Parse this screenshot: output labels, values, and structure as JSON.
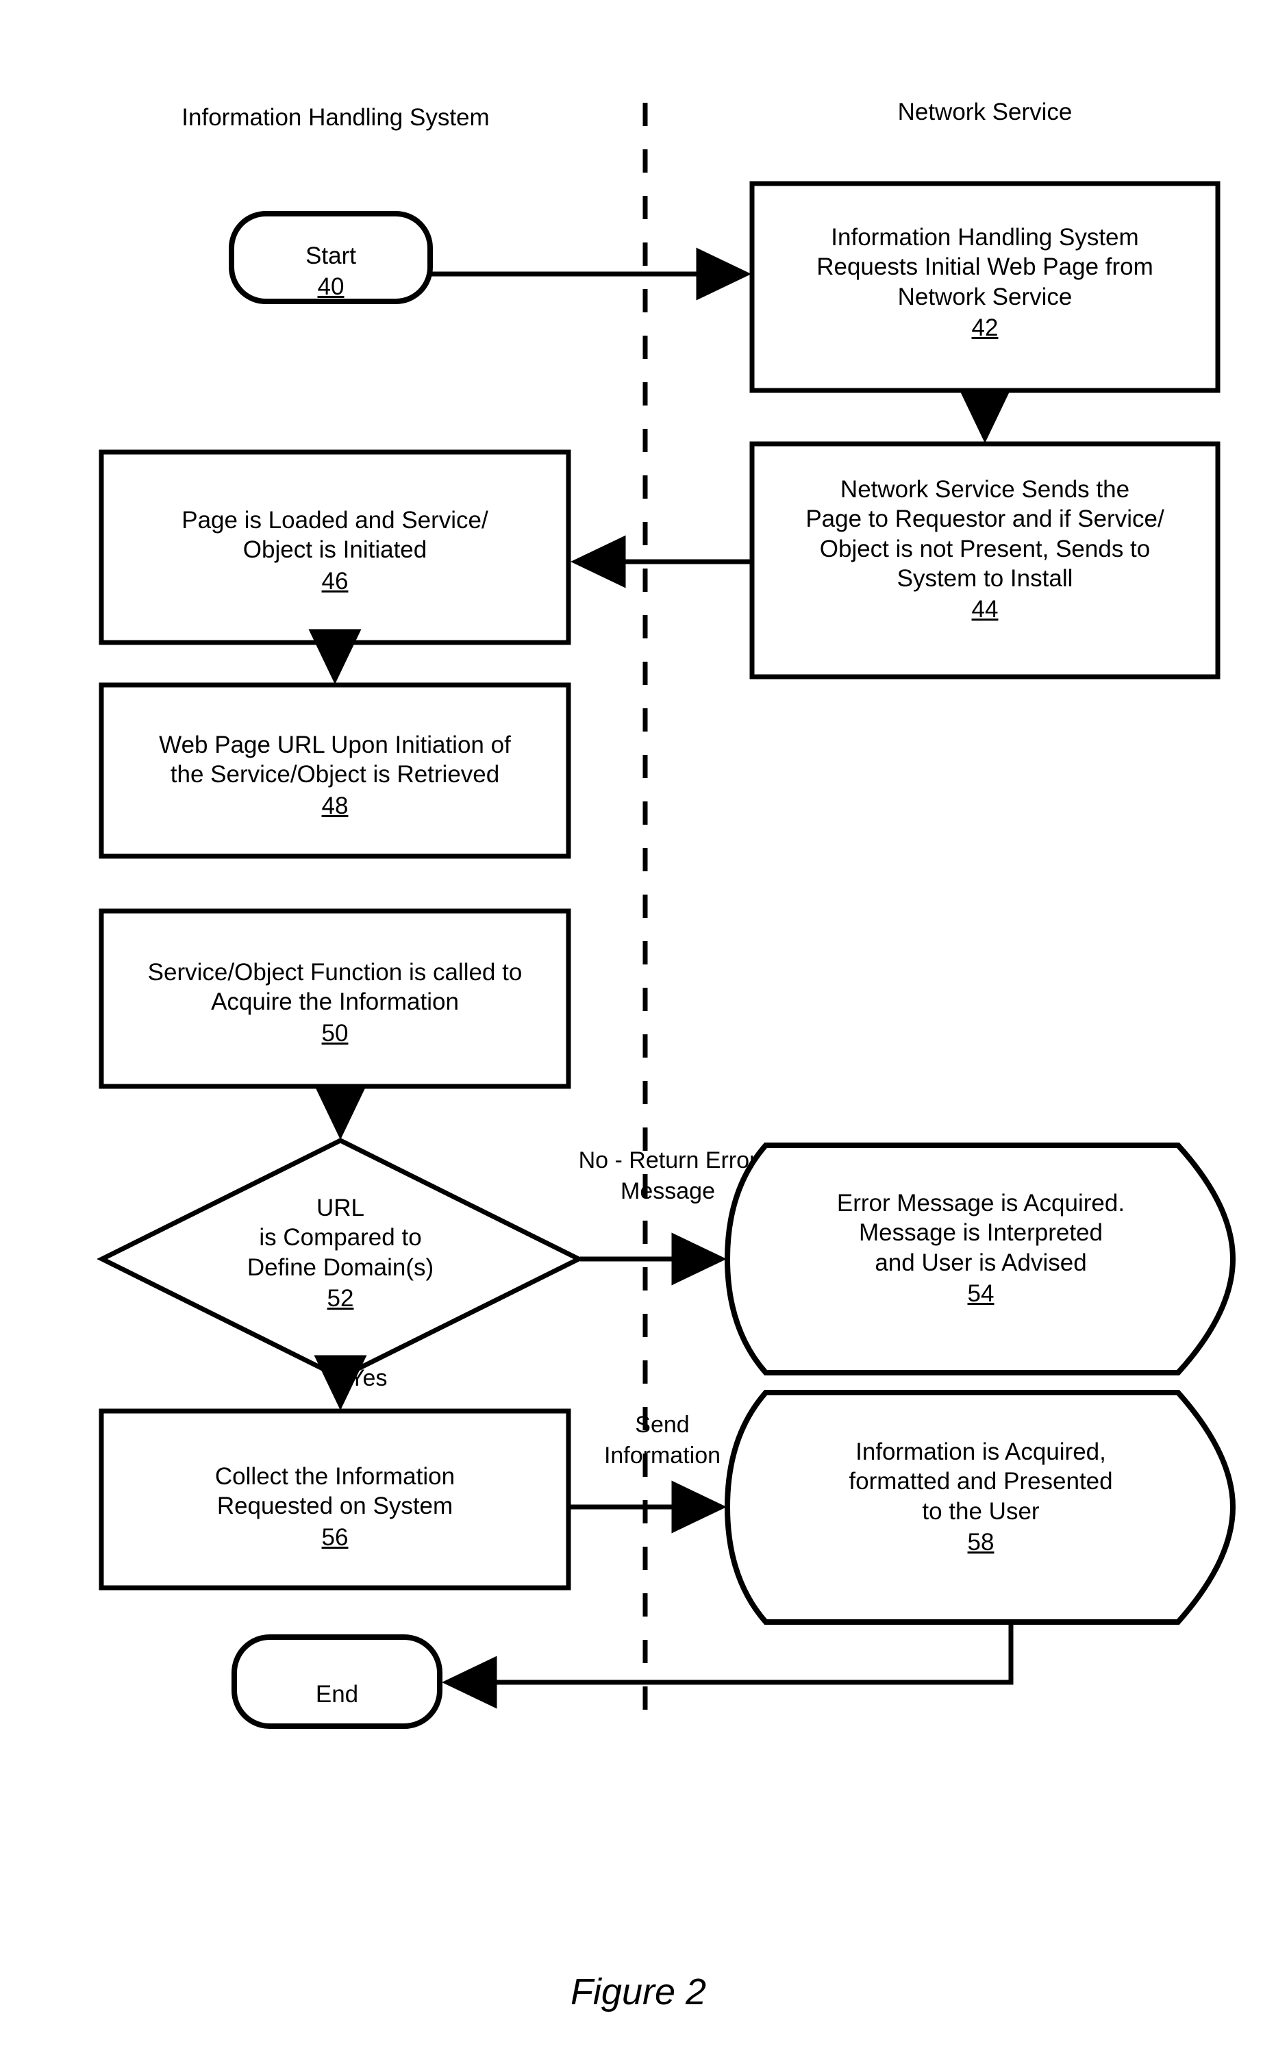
{
  "figure": {
    "caption": "Figure 2"
  },
  "swimlanes": [
    {
      "id": "information-handling-system",
      "label": "Information Handling System"
    },
    {
      "id": "network-service",
      "label": "Network Service"
    }
  ],
  "nodes": [
    {
      "id": "start",
      "shape": "terminator",
      "lane": "information-handling-system",
      "text": "Start",
      "number": "40"
    },
    {
      "id": "request-initial-page",
      "shape": "process",
      "lane": "network-service",
      "text": "Information Handling System\nRequests Initial Web Page from\nNetwork Service",
      "number": "42"
    },
    {
      "id": "network-sends-page",
      "shape": "process",
      "lane": "network-service",
      "text": "Network Service Sends the\nPage to Requestor and if Service/\nObject is not Present, Sends to\nSystem to Install",
      "number": "44"
    },
    {
      "id": "page-loaded",
      "shape": "process",
      "lane": "information-handling-system",
      "text": "Page is Loaded and Service/\nObject is Initiated",
      "number": "46"
    },
    {
      "id": "url-retrieved",
      "shape": "process",
      "lane": "information-handling-system",
      "text": "Web Page URL Upon Initiation of\nthe Service/Object is Retrieved",
      "number": "48"
    },
    {
      "id": "function-called",
      "shape": "process",
      "lane": "information-handling-system",
      "text": "Service/Object Function is called to\nAcquire the Information",
      "number": "50"
    },
    {
      "id": "url-compared",
      "shape": "decision",
      "lane": "information-handling-system",
      "text": "URL\nis Compared to\nDefine Domain(s)",
      "number": "52"
    },
    {
      "id": "error-message-acquired",
      "shape": "display",
      "lane": "network-service",
      "text": "Error Message is Acquired.\nMessage is Interpreted\nand User is Advised",
      "number": "54"
    },
    {
      "id": "collect-information",
      "shape": "process",
      "lane": "information-handling-system",
      "text": "Collect the Information\nRequested on System",
      "number": "56"
    },
    {
      "id": "information-presented",
      "shape": "display",
      "lane": "network-service",
      "text": "Information is Acquired,\nformatted and Presented\nto the User",
      "number": "58"
    },
    {
      "id": "end",
      "shape": "terminator",
      "lane": "information-handling-system",
      "text": "End",
      "number": ""
    }
  ],
  "edge_labels": [
    {
      "id": "no-return-error",
      "text": "No - Return Error\nMessage"
    },
    {
      "id": "yes",
      "text": "Yes"
    },
    {
      "id": "send-information",
      "text": "Send\nInformation"
    }
  ],
  "style": {
    "stroke": "#000000",
    "fill": "#ffffff",
    "background": "#ffffff"
  }
}
